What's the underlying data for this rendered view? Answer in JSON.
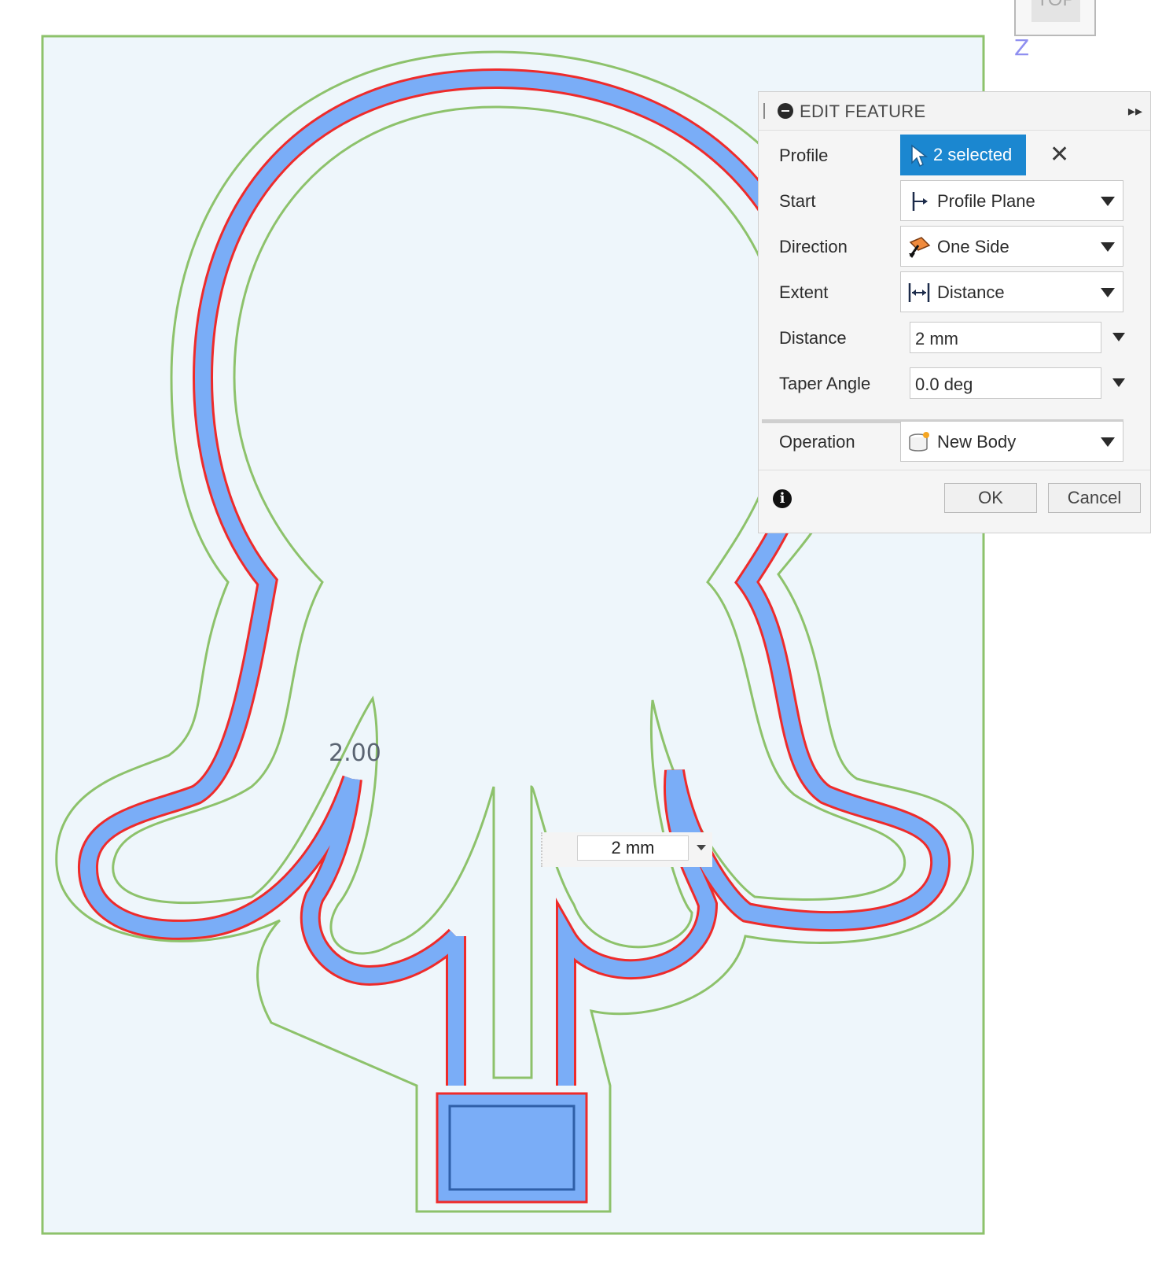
{
  "view_cube": {
    "face_label": "TOP",
    "axis_label": "Z"
  },
  "canvas": {
    "dimension_label": "2.00",
    "inline_distance_value": "2 mm"
  },
  "dialog": {
    "title": "EDIT FEATURE",
    "rows": {
      "profile": {
        "label": "Profile",
        "value": "2 selected"
      },
      "start": {
        "label": "Start",
        "value": "Profile Plane"
      },
      "direction": {
        "label": "Direction",
        "value": "One Side"
      },
      "extent": {
        "label": "Extent",
        "value": "Distance"
      },
      "distance": {
        "label": "Distance",
        "value": "2 mm"
      },
      "taper": {
        "label": "Taper Angle",
        "value": "0.0 deg"
      },
      "operation": {
        "label": "Operation",
        "value": "New Body"
      }
    },
    "buttons": {
      "ok": "OK",
      "cancel": "Cancel"
    }
  },
  "colors": {
    "canvas_bg": "#eef6fb",
    "sketch_green": "#8dc26b",
    "profile_blue": "#7aadf7",
    "profile_red": "#ee2b2b",
    "selected_button": "#1b87d0"
  }
}
